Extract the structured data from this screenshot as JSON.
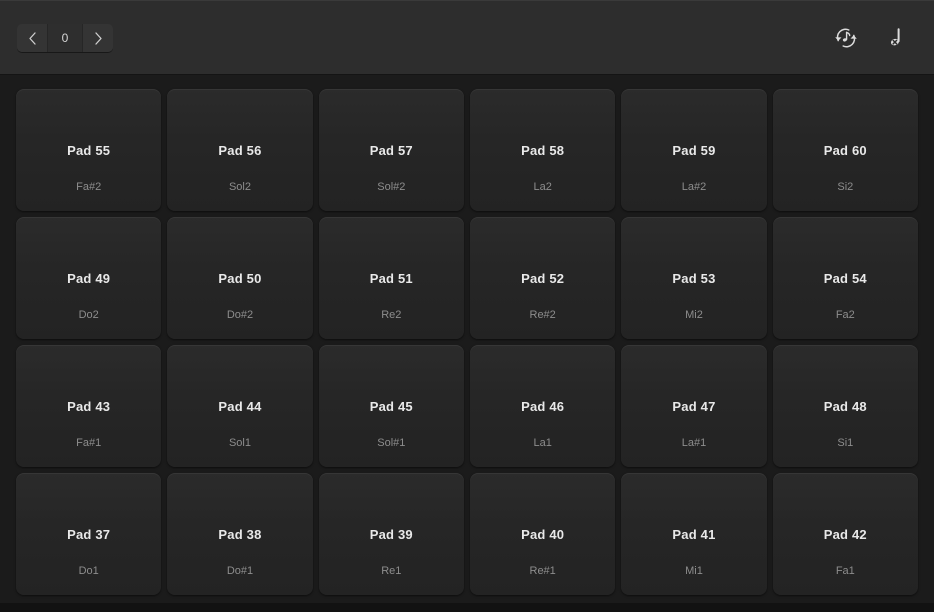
{
  "window": {
    "background_color": "#1b1b1b",
    "header_color": "#2d2d2d"
  },
  "header": {
    "stepper": {
      "prev_label": "‹",
      "prev_icon": "chevron-left-icon",
      "value": "0",
      "next_label": "›",
      "next_icon": "chevron-right-icon"
    },
    "tools": [
      {
        "name": "midi-note-refresh-icon",
        "label": ""
      },
      {
        "name": "note-off-icon",
        "label": ""
      }
    ]
  },
  "pads": {
    "accent_text_color": "#e9e9e9",
    "note_text_color": "#8d8d8d",
    "rows": [
      [
        {
          "name": "Pad 55",
          "note": "Fa#2"
        },
        {
          "name": "Pad 56",
          "note": "Sol2"
        },
        {
          "name": "Pad 57",
          "note": "Sol#2"
        },
        {
          "name": "Pad 58",
          "note": "La2"
        },
        {
          "name": "Pad 59",
          "note": "La#2"
        },
        {
          "name": "Pad 60",
          "note": "Si2"
        }
      ],
      [
        {
          "name": "Pad 49",
          "note": "Do2"
        },
        {
          "name": "Pad 50",
          "note": "Do#2"
        },
        {
          "name": "Pad 51",
          "note": "Re2"
        },
        {
          "name": "Pad 52",
          "note": "Re#2"
        },
        {
          "name": "Pad 53",
          "note": "Mi2"
        },
        {
          "name": "Pad 54",
          "note": "Fa2"
        }
      ],
      [
        {
          "name": "Pad 43",
          "note": "Fa#1"
        },
        {
          "name": "Pad 44",
          "note": "Sol1"
        },
        {
          "name": "Pad 45",
          "note": "Sol#1"
        },
        {
          "name": "Pad 46",
          "note": "La1"
        },
        {
          "name": "Pad 47",
          "note": "La#1"
        },
        {
          "name": "Pad 48",
          "note": "Si1"
        }
      ],
      [
        {
          "name": "Pad 37",
          "note": "Do1"
        },
        {
          "name": "Pad 38",
          "note": "Do#1"
        },
        {
          "name": "Pad 39",
          "note": "Re1"
        },
        {
          "name": "Pad 40",
          "note": "Re#1"
        },
        {
          "name": "Pad 41",
          "note": "Mi1"
        },
        {
          "name": "Pad 42",
          "note": "Fa1"
        }
      ]
    ]
  }
}
